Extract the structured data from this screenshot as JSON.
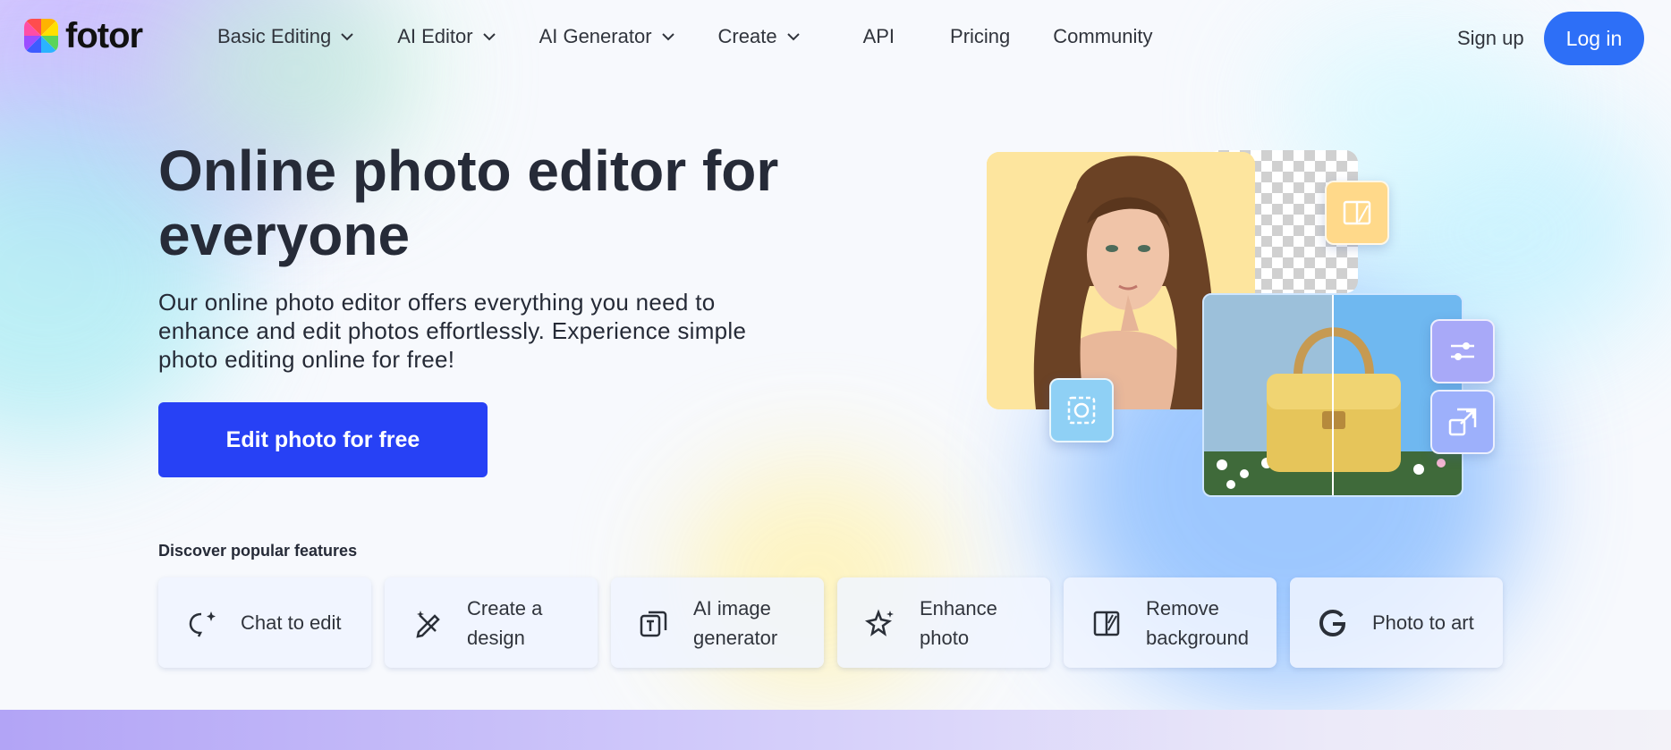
{
  "brand": {
    "name": "fotor"
  },
  "nav": {
    "items": [
      {
        "label": "Basic Editing",
        "dropdown": true
      },
      {
        "label": "AI Editor",
        "dropdown": true
      },
      {
        "label": "AI Generator",
        "dropdown": true
      },
      {
        "label": "Create",
        "dropdown": true
      },
      {
        "label": "API",
        "dropdown": false
      },
      {
        "label": "Pricing",
        "dropdown": false
      },
      {
        "label": "Community",
        "dropdown": false
      }
    ],
    "signup_label": "Sign up",
    "login_label": "Log in"
  },
  "hero": {
    "title": "Online photo editor for everyone",
    "description": "Our online photo editor offers everything you need to enhance and edit photos effortlessly. Experience simple photo editing online for free!",
    "cta_label": "Edit photo for free"
  },
  "features": {
    "heading": "Discover popular features",
    "items": [
      {
        "label": "Chat to edit",
        "icon": "chat-sparkle-icon"
      },
      {
        "label": "Create a design",
        "icon": "pen-ruler-icon"
      },
      {
        "label": "AI image generator",
        "icon": "ai-text-image-icon"
      },
      {
        "label": "Enhance photo",
        "icon": "sparkle-star-icon"
      },
      {
        "label": "Remove background",
        "icon": "background-split-icon"
      },
      {
        "label": "Photo to art",
        "icon": "art-g-icon"
      }
    ]
  },
  "colors": {
    "primary_cta": "#2741f5",
    "login_button": "#2d6ff7",
    "text_dark": "#262b38"
  }
}
